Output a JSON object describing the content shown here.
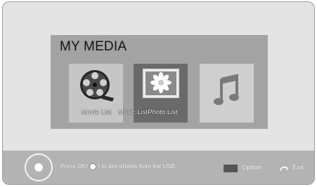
{
  "menu": {
    "title": "MY MEDIA",
    "items": [
      {
        "label": "Movie List",
        "icon": "film-reel-icon",
        "selected": false
      },
      {
        "label": "Music List",
        "icon": "music-note-icon",
        "selected": false
      },
      {
        "label": "Photo List",
        "icon": "flower-photo-icon",
        "selected": true
      }
    ]
  },
  "footer": {
    "hint_prefix": "Press OK(",
    "hint_suffix": ") to see photos from the USB.",
    "option_label": "Option",
    "exit_label": "Exit"
  }
}
